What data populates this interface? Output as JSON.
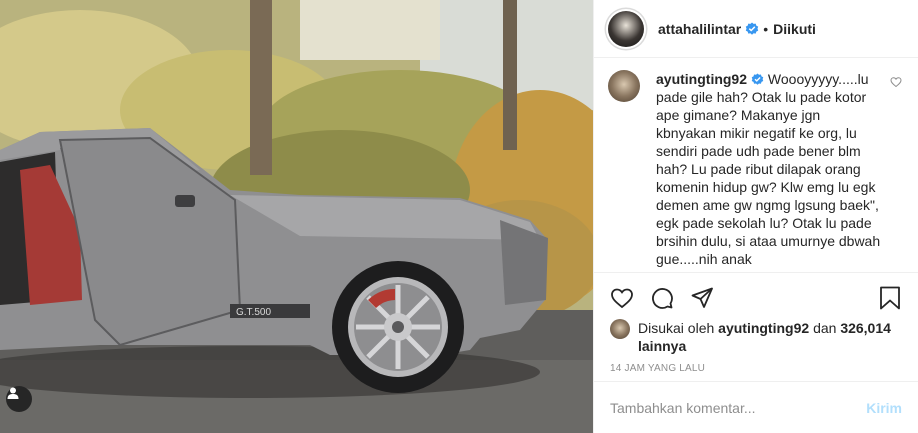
{
  "header": {
    "username": "attahalilintar",
    "separator": "•",
    "follow_status": "Diikuti"
  },
  "comment": {
    "username": "ayutingting92",
    "text": "Woooyyyyy.....lu pade gile hah? Otak lu pade kotor ape gimane? Makanye jgn kbnyakan mikir negatif ke org, lu sendiri pade udh pade bener blm hah? Lu pade ribut dilapak orang komenin hidup gw? Klw emg lu egk demen ame gw ngmg lgsung baek\", egk pade sekolah lu? Otak lu pade brsihin dulu, si ataa umurnye dbwah gue.....nih anak"
  },
  "likes": {
    "prefix": "Disukai oleh",
    "user": "ayutingting92",
    "middle": "dan",
    "count": "326,014 lainnya"
  },
  "timestamp": "14 JAM YANG LALU",
  "add_comment": {
    "placeholder": "Tambahkan komentar...",
    "post_label": "Kirim"
  },
  "media": {
    "car_badge": "G.T.500"
  },
  "colors": {
    "verified": "#3897f0",
    "post_disabled": "#b2dffc",
    "muted": "#8e8e8e"
  }
}
